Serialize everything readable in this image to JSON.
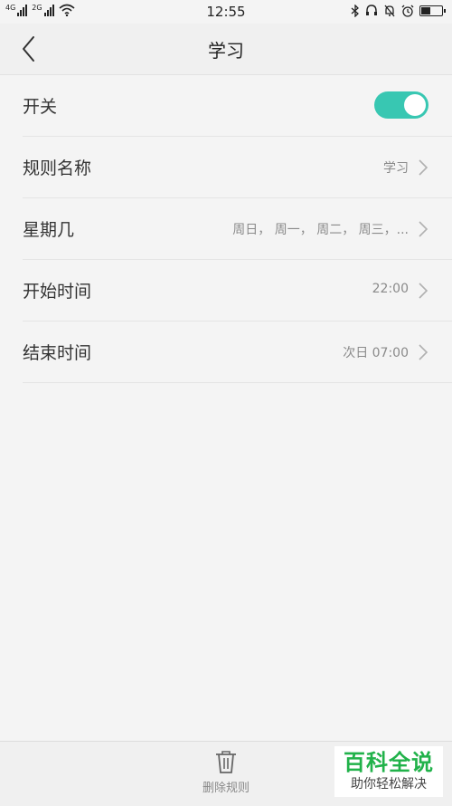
{
  "status_bar": {
    "net1": "4G",
    "net2": "2G",
    "time": "12:55",
    "battery_level": 0.5
  },
  "header": {
    "title": "学习",
    "back_icon": "chevron-left-icon"
  },
  "settings": {
    "switch": {
      "label": "开关",
      "on": true,
      "accent": "#38c7b2"
    },
    "rule_name": {
      "label": "规则名称",
      "value": "学习"
    },
    "weekday": {
      "label": "星期几",
      "value": "周日， 周一， 周二， 周三，..."
    },
    "start_time": {
      "label": "开始时间",
      "value": "22:00"
    },
    "end_time": {
      "label": "结束时间",
      "value": "次日 07:00"
    }
  },
  "bottom": {
    "delete_label": "删除规则",
    "delete_icon": "trash-icon"
  },
  "watermark": {
    "top": "百科全说",
    "bottom": "助你轻松解决"
  }
}
